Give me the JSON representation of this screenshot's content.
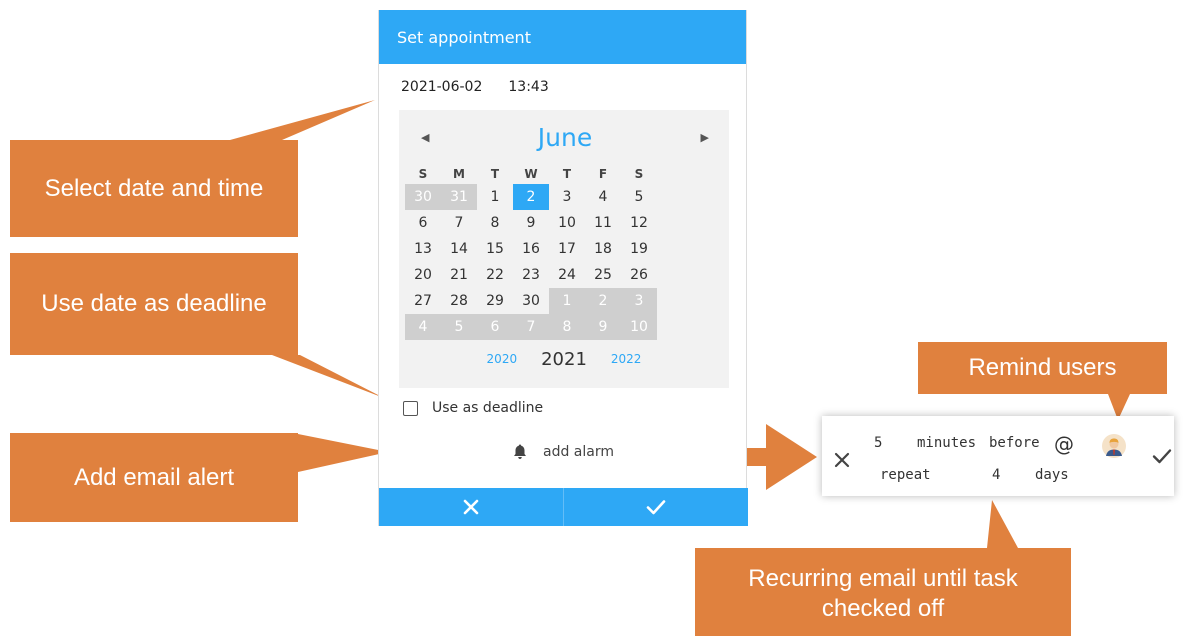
{
  "dialog": {
    "title": "Set appointment",
    "date": "2021-06-02",
    "time": "13:43",
    "calendar": {
      "month": "June",
      "weekdays": [
        "S",
        "M",
        "T",
        "W",
        "T",
        "F",
        "S"
      ],
      "weeks": [
        [
          {
            "d": "30",
            "other": true
          },
          {
            "d": "31",
            "other": true
          },
          {
            "d": "1"
          },
          {
            "d": "2",
            "selected": true
          },
          {
            "d": "3"
          },
          {
            "d": "4"
          },
          {
            "d": "5"
          }
        ],
        [
          {
            "d": "6"
          },
          {
            "d": "7"
          },
          {
            "d": "8"
          },
          {
            "d": "9"
          },
          {
            "d": "10"
          },
          {
            "d": "11"
          },
          {
            "d": "12"
          }
        ],
        [
          {
            "d": "13"
          },
          {
            "d": "14"
          },
          {
            "d": "15"
          },
          {
            "d": "16"
          },
          {
            "d": "17"
          },
          {
            "d": "18"
          },
          {
            "d": "19"
          }
        ],
        [
          {
            "d": "20"
          },
          {
            "d": "21"
          },
          {
            "d": "22"
          },
          {
            "d": "23"
          },
          {
            "d": "24"
          },
          {
            "d": "25"
          },
          {
            "d": "26"
          }
        ],
        [
          {
            "d": "27"
          },
          {
            "d": "28"
          },
          {
            "d": "29"
          },
          {
            "d": "30"
          },
          {
            "d": "1",
            "other": true
          },
          {
            "d": "2",
            "other": true
          },
          {
            "d": "3",
            "other": true
          }
        ],
        [
          {
            "d": "4",
            "other": true
          },
          {
            "d": "5",
            "other": true
          },
          {
            "d": "6",
            "other": true
          },
          {
            "d": "7",
            "other": true
          },
          {
            "d": "8",
            "other": true
          },
          {
            "d": "9",
            "other": true
          },
          {
            "d": "10",
            "other": true
          }
        ]
      ],
      "prev_year": "2020",
      "current_year": "2021",
      "next_year": "2022"
    },
    "deadline_label": "Use as deadline",
    "alarm_label": "add alarm"
  },
  "alarm_panel": {
    "minutes_value": "5",
    "minutes_label": "minutes",
    "before_label": "before",
    "at_symbol": "@",
    "repeat_label": "repeat",
    "repeat_value": "4",
    "days_label": "days"
  },
  "callouts": {
    "select_date": "Select date and time",
    "use_deadline": "Use date as deadline",
    "email_alert": "Add email alert",
    "remind_users": "Remind users",
    "recurring": "Recurring email until task checked off"
  },
  "colors": {
    "accent": "#2ea8f5",
    "callout": "#e0813e",
    "other_month_bg": "#cfcfcf"
  },
  "icons": [
    "chevron-left-icon",
    "chevron-right-icon",
    "bell-icon",
    "close-icon",
    "check-icon",
    "user-avatar-icon",
    "arrow-right-icon"
  ]
}
